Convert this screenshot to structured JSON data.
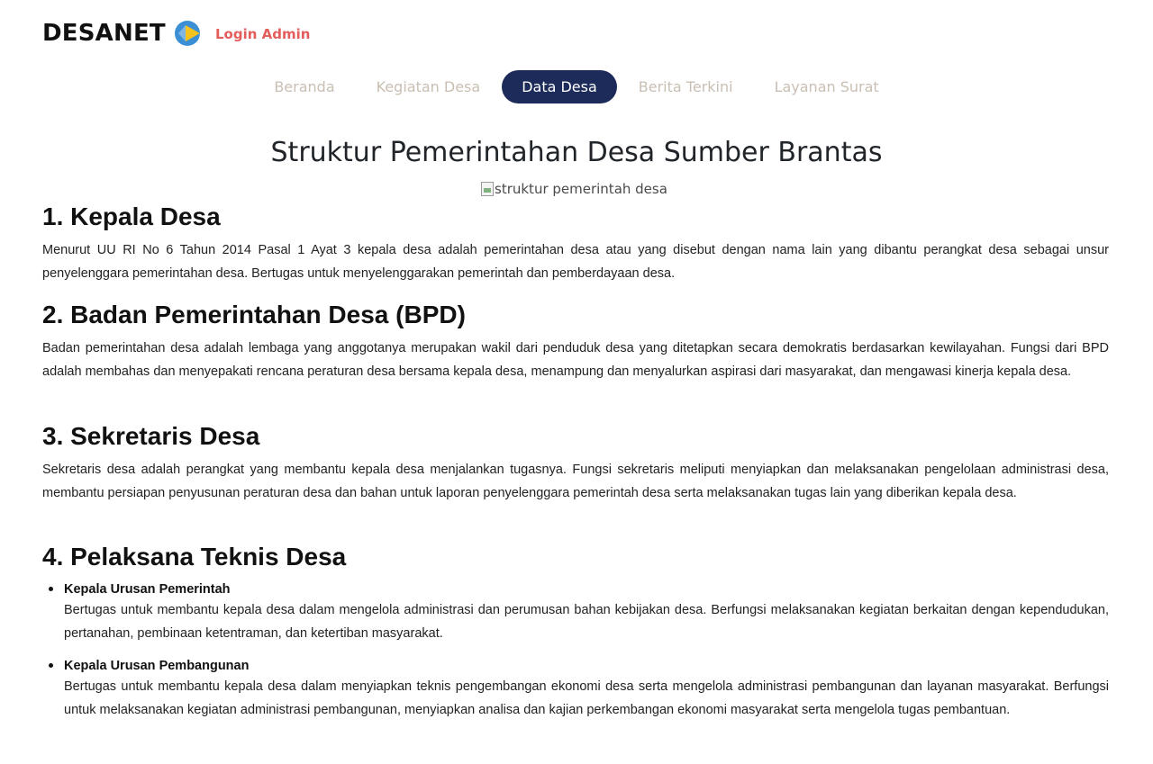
{
  "header": {
    "brand": "DESANET",
    "login_label": "Login Admin"
  },
  "nav": {
    "items": [
      {
        "label": "Beranda"
      },
      {
        "label": "Kegiatan Desa"
      },
      {
        "label": "Data Desa"
      },
      {
        "label": "Berita Terkini"
      },
      {
        "label": "Layanan Surat"
      }
    ],
    "active": "Data Desa"
  },
  "main": {
    "title": "Struktur Pemerintahan Desa Sumber Brantas",
    "image_alt": "struktur pemerintah desa",
    "sections": [
      {
        "heading": "1. Kepala Desa",
        "body": "Menurut UU RI No 6 Tahun 2014 Pasal 1 Ayat 3 kepala desa adalah pemerintahan desa atau yang disebut dengan nama lain yang dibantu perangkat desa sebagai unsur penyelenggara pemerintahan desa. Bertugas untuk menyelenggarakan pemerintah dan pemberdayaan desa."
      },
      {
        "heading": "2. Badan Pemerintahan Desa (BPD)",
        "body": "Badan pemerintahan desa adalah lembaga yang anggotanya merupakan wakil dari penduduk desa yang ditetapkan secara demokratis berdasarkan kewilayahan. Fungsi dari BPD adalah membahas dan menyepakati rencana peraturan desa bersama kepala desa, menampung dan menyalurkan aspirasi dari masyarakat, dan mengawasi kinerja kepala desa."
      },
      {
        "heading": "3. Sekretaris Desa",
        "body": "Sekretaris desa adalah perangkat yang membantu kepala desa menjalankan tugasnya. Fungsi sekretaris meliputi menyiapkan dan melaksanakan pengelolaan administrasi desa, membantu persiapan penyusunan peraturan desa dan bahan untuk laporan penyelenggara pemerintah desa serta melaksanakan tugas lain yang diberikan kepala desa."
      },
      {
        "heading": "4. Pelaksana Teknis Desa",
        "items": [
          {
            "title": "Kepala Urusan Pemerintah",
            "desc": "Bertugas untuk membantu kepala desa dalam mengelola administrasi dan perumusan bahan kebijakan desa. Berfungsi melaksanakan kegiatan berkaitan dengan kependudukan, pertanahan, pembinaan ketentraman, dan ketertiban masyarakat."
          },
          {
            "title": "Kepala Urusan Pembangunan",
            "desc": "Bertugas untuk membantu kepala desa dalam menyiapkan teknis pengembangan ekonomi desa serta mengelola administrasi pembangunan dan layanan masyarakat. Berfungsi untuk melaksanakan kegiatan administrasi pembangunan, menyiapkan analisa dan kajian perkembangan ekonomi masyarakat serta mengelola tugas pembantuan."
          }
        ]
      }
    ]
  },
  "colors": {
    "nav_active_bg": "#1d2b5a",
    "nav_inactive_text": "#c9bfb3",
    "login_text": "#e35d5b",
    "logo_blue": "#3b8fd4",
    "logo_yellow": "#f4c21c"
  }
}
